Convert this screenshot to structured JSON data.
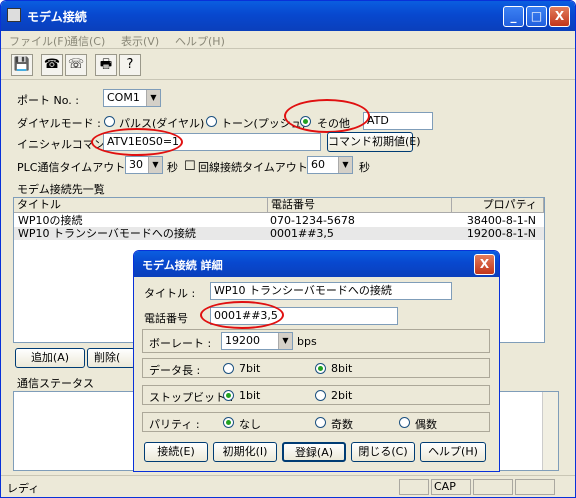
{
  "window": {
    "title": "モデム接続",
    "min": "_",
    "max": "□",
    "close": "X"
  },
  "menu": [
    "ファイル(F)",
    "通信(C)",
    "表示(V)",
    "ヘルプ(H)"
  ],
  "toolbar": {
    "save": "💾",
    "connect": "☎",
    "disconnect": "☏",
    "print": "🖶",
    "help": "?"
  },
  "port": {
    "label": "ポート No. :",
    "value": "COM1"
  },
  "dial": {
    "label": "ダイヤルモード :",
    "pulse": "パルス(ダイヤル)",
    "tone": "トーン(プッシュ)",
    "other": "その他",
    "other_value": "ATD",
    "selected": "other"
  },
  "init": {
    "label": "イニシャルコマンド :",
    "value": "ATV1E0S0=1",
    "reset_button": "コマンド初期値(E)"
  },
  "plc_timeout": {
    "label": "PLC通信タイムアウト :",
    "value": "30",
    "unit": "秒"
  },
  "line_timeout": {
    "label": "回線接続タイムアウト :",
    "value": "60",
    "unit": "秒"
  },
  "list": {
    "label": "モデム接続先一覧",
    "headers": [
      "タイトル",
      "電話番号",
      "プロパティ"
    ],
    "rows": [
      {
        "title": "WP10の接続",
        "phone": "070-1234-5678",
        "prop": "38400-8-1-N"
      },
      {
        "title": "WP10 トランシーバモードへの接続",
        "phone": "0001##3,5",
        "prop": "19200-8-1-N"
      }
    ]
  },
  "buttons": {
    "add": "追加(A)",
    "delete": "削除("
  },
  "comm_status": {
    "label": "通信ステータス"
  },
  "status": {
    "text": "レディ",
    "cap": "CAP"
  },
  "dialog": {
    "title": "モデム接続 詳細",
    "close": "X",
    "title_label": "タイトル :",
    "title_value": "WP10 トランシーバモードへの接続",
    "phone_label": "電話番号",
    "phone_value": "0001##3,5",
    "baud_label": "ボーレート :",
    "baud_value": "19200",
    "baud_unit": "bps",
    "data_label": "データ長 :",
    "data_7": "7bit",
    "data_8": "8bit",
    "stop_label": "ストップビット :",
    "stop_1": "1bit",
    "stop_2": "2bit",
    "parity_label": "パリティ :",
    "parity_none": "なし",
    "parity_odd": "奇数",
    "parity_even": "偶数",
    "btn_connect": "接続(E)",
    "btn_init": "初期化(I)",
    "btn_register": "登録(A)",
    "btn_close": "閉じる(C)",
    "btn_help": "ヘルプ(H)"
  }
}
